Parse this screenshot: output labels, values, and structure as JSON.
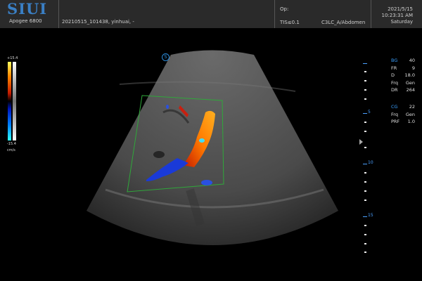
{
  "header": {
    "logo": "SIUI",
    "model": "Apogee 6800",
    "patient": "20210515_101438, yinhuai, -",
    "op_label": "Op:",
    "tis": "TIS≤0.1",
    "preset": "C3LC_A/Abdomen",
    "date": "2021/5/15",
    "time": "10:23:31 AM",
    "weekday": "Saturday"
  },
  "scale": {
    "top": "+15.4",
    "bottom": "-15.4",
    "unit": "cm/s"
  },
  "indicator": "S",
  "depth_labels": [
    "5",
    "10",
    "15"
  ],
  "bmode_params": [
    {
      "key": "BG",
      "value": "40"
    },
    {
      "key": "FR",
      "value": "9"
    },
    {
      "key": "D",
      "value": "18.0"
    },
    {
      "key": "Frq",
      "value": "Gen"
    },
    {
      "key": "DR",
      "value": "264"
    }
  ],
  "color_params": [
    {
      "key": "CG",
      "value": "22"
    },
    {
      "key": "Frq",
      "value": "Gen"
    },
    {
      "key": "PRF",
      "value": "1.0"
    }
  ],
  "colors": {
    "logo": "#3a7fc4",
    "accent_blue": "#3aa0ff",
    "header_bg": "#2a2a2a",
    "roi_green": "#2fa83a"
  }
}
